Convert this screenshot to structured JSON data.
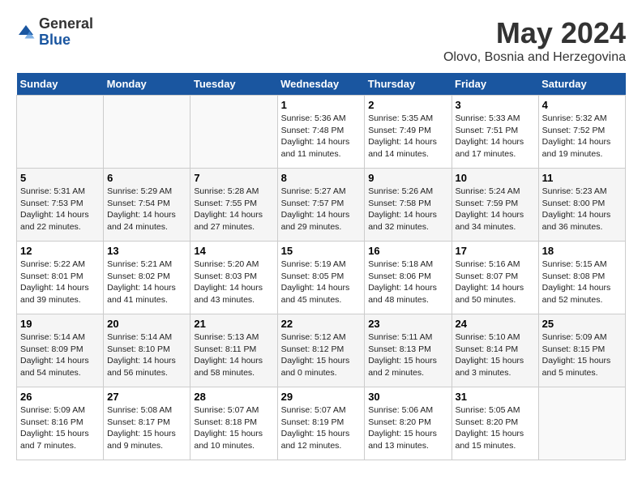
{
  "app": {
    "name_general": "General",
    "name_blue": "Blue"
  },
  "calendar": {
    "month": "May 2024",
    "location": "Olovo, Bosnia and Herzegovina",
    "headers": [
      "Sunday",
      "Monday",
      "Tuesday",
      "Wednesday",
      "Thursday",
      "Friday",
      "Saturday"
    ],
    "weeks": [
      [
        {
          "day": "",
          "info": ""
        },
        {
          "day": "",
          "info": ""
        },
        {
          "day": "",
          "info": ""
        },
        {
          "day": "1",
          "info": "Sunrise: 5:36 AM\nSunset: 7:48 PM\nDaylight: 14 hours\nand 11 minutes."
        },
        {
          "day": "2",
          "info": "Sunrise: 5:35 AM\nSunset: 7:49 PM\nDaylight: 14 hours\nand 14 minutes."
        },
        {
          "day": "3",
          "info": "Sunrise: 5:33 AM\nSunset: 7:51 PM\nDaylight: 14 hours\nand 17 minutes."
        },
        {
          "day": "4",
          "info": "Sunrise: 5:32 AM\nSunset: 7:52 PM\nDaylight: 14 hours\nand 19 minutes."
        }
      ],
      [
        {
          "day": "5",
          "info": "Sunrise: 5:31 AM\nSunset: 7:53 PM\nDaylight: 14 hours\nand 22 minutes."
        },
        {
          "day": "6",
          "info": "Sunrise: 5:29 AM\nSunset: 7:54 PM\nDaylight: 14 hours\nand 24 minutes."
        },
        {
          "day": "7",
          "info": "Sunrise: 5:28 AM\nSunset: 7:55 PM\nDaylight: 14 hours\nand 27 minutes."
        },
        {
          "day": "8",
          "info": "Sunrise: 5:27 AM\nSunset: 7:57 PM\nDaylight: 14 hours\nand 29 minutes."
        },
        {
          "day": "9",
          "info": "Sunrise: 5:26 AM\nSunset: 7:58 PM\nDaylight: 14 hours\nand 32 minutes."
        },
        {
          "day": "10",
          "info": "Sunrise: 5:24 AM\nSunset: 7:59 PM\nDaylight: 14 hours\nand 34 minutes."
        },
        {
          "day": "11",
          "info": "Sunrise: 5:23 AM\nSunset: 8:00 PM\nDaylight: 14 hours\nand 36 minutes."
        }
      ],
      [
        {
          "day": "12",
          "info": "Sunrise: 5:22 AM\nSunset: 8:01 PM\nDaylight: 14 hours\nand 39 minutes."
        },
        {
          "day": "13",
          "info": "Sunrise: 5:21 AM\nSunset: 8:02 PM\nDaylight: 14 hours\nand 41 minutes."
        },
        {
          "day": "14",
          "info": "Sunrise: 5:20 AM\nSunset: 8:03 PM\nDaylight: 14 hours\nand 43 minutes."
        },
        {
          "day": "15",
          "info": "Sunrise: 5:19 AM\nSunset: 8:05 PM\nDaylight: 14 hours\nand 45 minutes."
        },
        {
          "day": "16",
          "info": "Sunrise: 5:18 AM\nSunset: 8:06 PM\nDaylight: 14 hours\nand 48 minutes."
        },
        {
          "day": "17",
          "info": "Sunrise: 5:16 AM\nSunset: 8:07 PM\nDaylight: 14 hours\nand 50 minutes."
        },
        {
          "day": "18",
          "info": "Sunrise: 5:15 AM\nSunset: 8:08 PM\nDaylight: 14 hours\nand 52 minutes."
        }
      ],
      [
        {
          "day": "19",
          "info": "Sunrise: 5:14 AM\nSunset: 8:09 PM\nDaylight: 14 hours\nand 54 minutes."
        },
        {
          "day": "20",
          "info": "Sunrise: 5:14 AM\nSunset: 8:10 PM\nDaylight: 14 hours\nand 56 minutes."
        },
        {
          "day": "21",
          "info": "Sunrise: 5:13 AM\nSunset: 8:11 PM\nDaylight: 14 hours\nand 58 minutes."
        },
        {
          "day": "22",
          "info": "Sunrise: 5:12 AM\nSunset: 8:12 PM\nDaylight: 15 hours\nand 0 minutes."
        },
        {
          "day": "23",
          "info": "Sunrise: 5:11 AM\nSunset: 8:13 PM\nDaylight: 15 hours\nand 2 minutes."
        },
        {
          "day": "24",
          "info": "Sunrise: 5:10 AM\nSunset: 8:14 PM\nDaylight: 15 hours\nand 3 minutes."
        },
        {
          "day": "25",
          "info": "Sunrise: 5:09 AM\nSunset: 8:15 PM\nDaylight: 15 hours\nand 5 minutes."
        }
      ],
      [
        {
          "day": "26",
          "info": "Sunrise: 5:09 AM\nSunset: 8:16 PM\nDaylight: 15 hours\nand 7 minutes."
        },
        {
          "day": "27",
          "info": "Sunrise: 5:08 AM\nSunset: 8:17 PM\nDaylight: 15 hours\nand 9 minutes."
        },
        {
          "day": "28",
          "info": "Sunrise: 5:07 AM\nSunset: 8:18 PM\nDaylight: 15 hours\nand 10 minutes."
        },
        {
          "day": "29",
          "info": "Sunrise: 5:07 AM\nSunset: 8:19 PM\nDaylight: 15 hours\nand 12 minutes."
        },
        {
          "day": "30",
          "info": "Sunrise: 5:06 AM\nSunset: 8:20 PM\nDaylight: 15 hours\nand 13 minutes."
        },
        {
          "day": "31",
          "info": "Sunrise: 5:05 AM\nSunset: 8:20 PM\nDaylight: 15 hours\nand 15 minutes."
        },
        {
          "day": "",
          "info": ""
        }
      ]
    ]
  }
}
